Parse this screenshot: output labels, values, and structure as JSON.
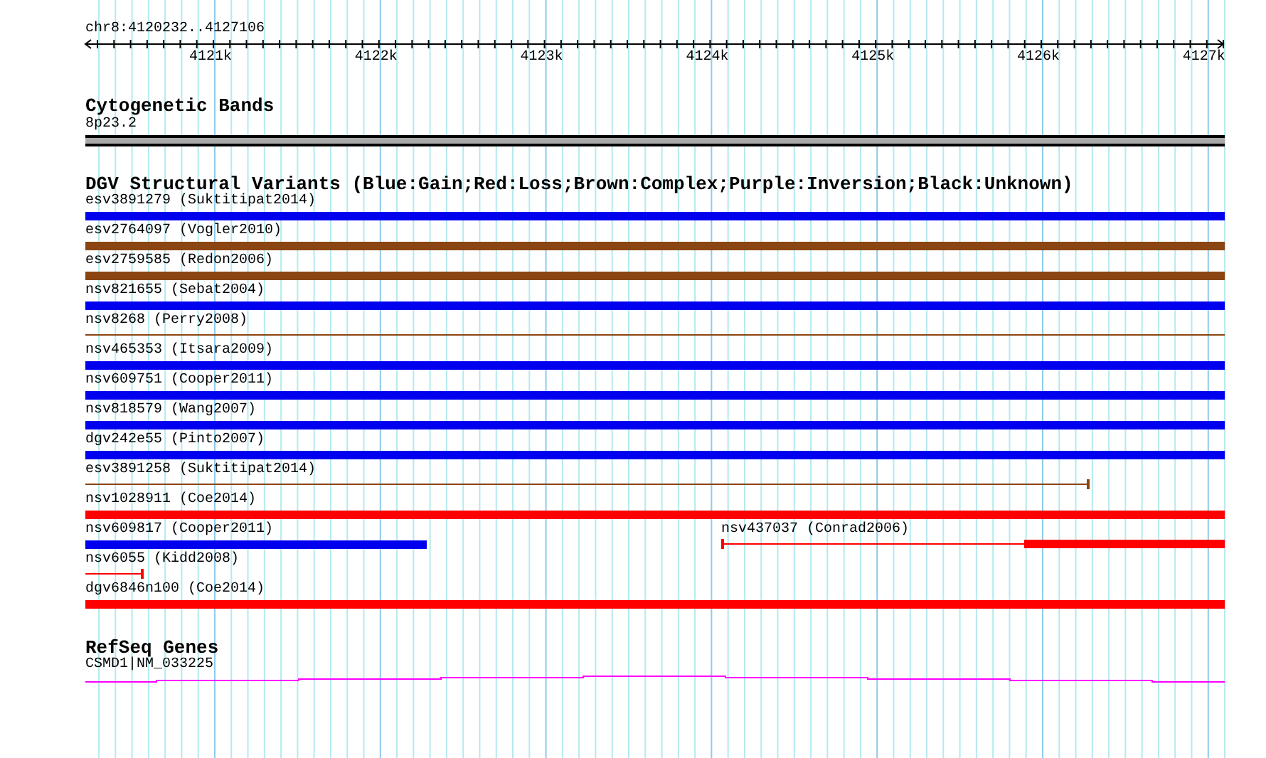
{
  "ruler": {
    "location": "chr8:4120232..4127106",
    "ticks": [
      "4121k",
      "4122k",
      "4123k",
      "4124k",
      "4125k",
      "4126k",
      "4127k"
    ]
  },
  "cytogenetic_bands": {
    "title": "Cytogenetic Bands",
    "band": "8p23.2"
  },
  "dgv_track": {
    "title": "DGV Structural Variants (Blue:Gain;Red:Loss;Brown:Complex;Purple:Inversion;Black:Unknown)",
    "rows": [
      {
        "features": [
          {
            "label": "esv3891279 (Suktitipat2014)",
            "color": "#0000ee",
            "kind": "bar"
          }
        ]
      },
      {
        "features": [
          {
            "label": "esv2764097 (Vogler2010)",
            "color": "#8b4513",
            "kind": "bar"
          }
        ]
      },
      {
        "features": [
          {
            "label": "esv2759585 (Redon2006)",
            "color": "#8b4513",
            "kind": "bar"
          }
        ]
      },
      {
        "features": [
          {
            "label": "nsv821655 (Sebat2004)",
            "color": "#0000ee",
            "kind": "bar"
          }
        ]
      },
      {
        "features": [
          {
            "label": "nsv8268 (Perry2008)",
            "color": "#8b4513",
            "kind": "line"
          }
        ]
      },
      {
        "features": [
          {
            "label": "nsv465353 (Itsara2009)",
            "color": "#0000ee",
            "kind": "bar"
          }
        ]
      },
      {
        "features": [
          {
            "label": "nsv609751 (Cooper2011)",
            "color": "#0000ee",
            "kind": "bar"
          }
        ]
      },
      {
        "features": [
          {
            "label": "nsv818579 (Wang2007)",
            "color": "#0000ee",
            "kind": "bar"
          }
        ]
      },
      {
        "features": [
          {
            "label": "dgv242e55 (Pinto2007)",
            "color": "#0000ee",
            "kind": "bar"
          }
        ]
      },
      {
        "features": [
          {
            "label": "esv3891258 (Suktitipat2014)",
            "color": "#8b4513",
            "kind": "line"
          }
        ]
      },
      {
        "features": [
          {
            "label": "nsv1028911 (Coe2014)",
            "color": "#ff0000",
            "kind": "bar"
          }
        ]
      },
      {
        "features": [
          {
            "label": "nsv609817 (Cooper2011)",
            "color": "#0000ee",
            "kind": "bar"
          },
          {
            "label": "nsv437037 (Conrad2006)",
            "color": "#ff0000",
            "kind": "split"
          }
        ]
      },
      {
        "features": [
          {
            "label": "nsv6055 (Kidd2008)",
            "color": "#ff0000",
            "kind": "line"
          }
        ]
      },
      {
        "features": [
          {
            "label": "dgv6846n100 (Coe2014)",
            "color": "#ff0000",
            "kind": "bar"
          }
        ]
      }
    ]
  },
  "refseq_genes": {
    "title": "RefSeq Genes",
    "gene": "CSMD1|NM_033225"
  }
}
